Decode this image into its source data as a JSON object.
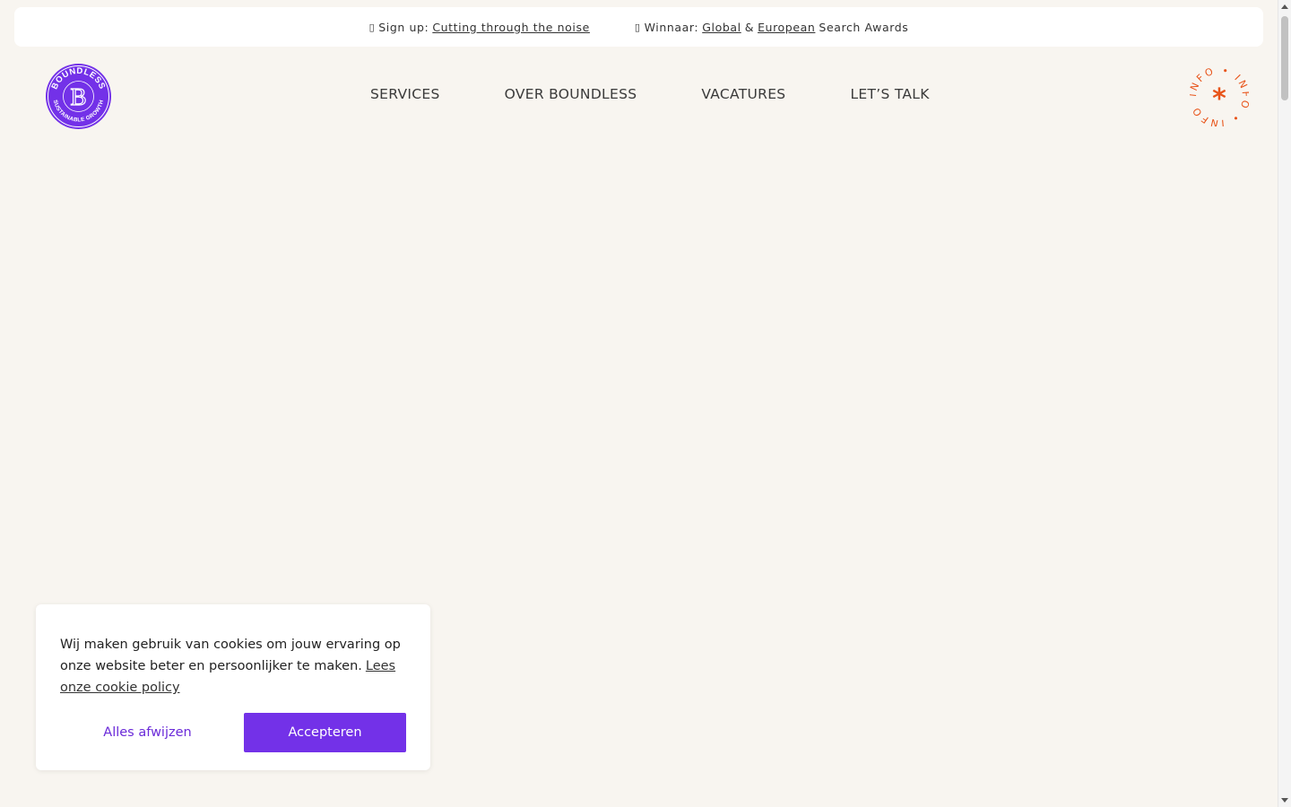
{
  "announcement": {
    "signup_icon": "glyph-box",
    "signup_prefix": "Sign up:",
    "signup_link": "Cutting through the noise",
    "award_icon": "glyph-box",
    "award_prefix": "Winnaar:",
    "award_link_global": "Global",
    "award_amp": "&",
    "award_link_european": "European",
    "award_suffix": "Search Awards"
  },
  "logo": {
    "top_text": "BOUNDLESS",
    "bottom_text": "SUSTAINABLE GROWTH",
    "letter": "B",
    "color": "#7331e8"
  },
  "nav": {
    "items": [
      {
        "label": "SERVICES"
      },
      {
        "label": "OVER BOUNDLESS"
      },
      {
        "label": "VACATURES"
      },
      {
        "label": "LET’S TALK"
      }
    ]
  },
  "info_badge": {
    "ring_text": "INFO • INFO • INFO •",
    "center_symbol": "*",
    "color": "#e8541a"
  },
  "cookie": {
    "message": "Wij maken gebruik van cookies om jouw ervaring op onze website beter en persoonlijker te maken.",
    "policy_link": "Lees onze cookie policy",
    "reject_label": "Alles afwijzen",
    "accept_label": "Accepteren",
    "accent_color": "#7331e8"
  }
}
